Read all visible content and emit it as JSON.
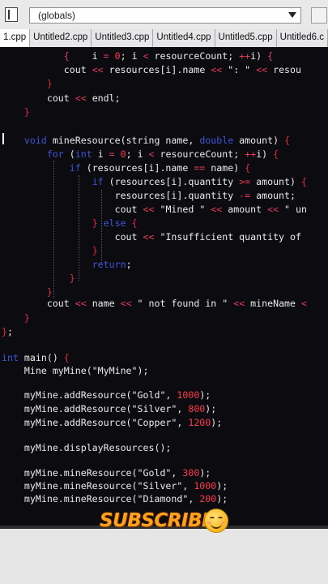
{
  "toolbar": {
    "scope_dropdown": "(globals)"
  },
  "tabs": [
    {
      "label": "1.cpp"
    },
    {
      "label": "Untitled2.cpp"
    },
    {
      "label": "Untitled3.cpp"
    },
    {
      "label": "Untitled4.cpp"
    },
    {
      "label": "Untitled5.cpp"
    },
    {
      "label": "Untitled6.c"
    }
  ],
  "overlay": {
    "subscribe_text": "SUBSCRIBE"
  },
  "colors": {
    "keyword": "#3f55d8",
    "number": "#ff3a4d",
    "operator": "#e43c58",
    "subscribe": "#ffa11c"
  },
  "code": {
    "l1": [
      {
        "t": "           "
      },
      {
        "t": "{",
        "c": "op"
      },
      {
        "t": "    i "
      },
      {
        "t": "=",
        "c": "op"
      },
      {
        "t": " "
      },
      {
        "t": "0",
        "c": "num"
      },
      {
        "t": "; i "
      },
      {
        "t": "<",
        "c": "op"
      },
      {
        "t": " resourceCount; "
      },
      {
        "t": "++",
        "c": "op"
      },
      {
        "t": "i) "
      },
      {
        "t": "{",
        "c": "op"
      }
    ],
    "l2": [
      {
        "t": "           cout "
      },
      {
        "t": "<<",
        "c": "op"
      },
      {
        "t": " resources[i].name "
      },
      {
        "t": "<<",
        "c": "op"
      },
      {
        "t": " \": \" "
      },
      {
        "t": "<<",
        "c": "op"
      },
      {
        "t": " resou"
      }
    ],
    "l3": [
      {
        "t": "        "
      },
      {
        "t": "}",
        "c": "red"
      }
    ],
    "l4": [
      {
        "t": "        cout "
      },
      {
        "t": "<<",
        "c": "op"
      },
      {
        "t": " endl;"
      }
    ],
    "l5": [
      {
        "t": "    "
      },
      {
        "t": "}",
        "c": "red"
      }
    ],
    "l6": [
      {
        "t": "    "
      },
      {
        "t": "void",
        "c": "kw"
      },
      {
        "t": " mineResource(string name, "
      },
      {
        "t": "double",
        "c": "kw"
      },
      {
        "t": " amount) "
      },
      {
        "t": "{",
        "c": "red"
      }
    ],
    "l7": [
      {
        "t": "        "
      },
      {
        "t": "for",
        "c": "kw"
      },
      {
        "t": " ("
      },
      {
        "t": "int",
        "c": "kw"
      },
      {
        "t": " i "
      },
      {
        "t": "=",
        "c": "op"
      },
      {
        "t": " "
      },
      {
        "t": "0",
        "c": "num"
      },
      {
        "t": "; i "
      },
      {
        "t": "<",
        "c": "op"
      },
      {
        "t": " resourceCount; "
      },
      {
        "t": "++",
        "c": "op"
      },
      {
        "t": "i) "
      },
      {
        "t": "{",
        "c": "red"
      }
    ],
    "l8": [
      {
        "t": "            "
      },
      {
        "t": "if",
        "c": "kw"
      },
      {
        "t": " (resources[i].name "
      },
      {
        "t": "==",
        "c": "op"
      },
      {
        "t": " name) "
      },
      {
        "t": "{",
        "c": "red"
      }
    ],
    "l9": [
      {
        "t": "                "
      },
      {
        "t": "if",
        "c": "kw"
      },
      {
        "t": " (resources[i].quantity "
      },
      {
        "t": ">=",
        "c": "op"
      },
      {
        "t": " amount) "
      },
      {
        "t": "{",
        "c": "red"
      }
    ],
    "l10": [
      {
        "t": "                    resources[i].quantity "
      },
      {
        "t": "-=",
        "c": "op"
      },
      {
        "t": " amount;"
      }
    ],
    "l11": [
      {
        "t": "                    cout "
      },
      {
        "t": "<<",
        "c": "op"
      },
      {
        "t": " \"Mined \" "
      },
      {
        "t": "<<",
        "c": "op"
      },
      {
        "t": " amount "
      },
      {
        "t": "<<",
        "c": "op"
      },
      {
        "t": " \" un"
      }
    ],
    "l12": [
      {
        "t": "                "
      },
      {
        "t": "}",
        "c": "red"
      },
      {
        "t": " "
      },
      {
        "t": "else",
        "c": "kw"
      },
      {
        "t": " "
      },
      {
        "t": "{",
        "c": "red"
      }
    ],
    "l13": [
      {
        "t": "                    cout "
      },
      {
        "t": "<<",
        "c": "op"
      },
      {
        "t": " \"Insufficient quantity of"
      }
    ],
    "l14": [
      {
        "t": "                "
      },
      {
        "t": "}",
        "c": "red"
      }
    ],
    "l15": [
      {
        "t": "                "
      },
      {
        "t": "return",
        "c": "kw"
      },
      {
        "t": ";"
      }
    ],
    "l16": [
      {
        "t": "            "
      },
      {
        "t": "}",
        "c": "red"
      }
    ],
    "l17": [
      {
        "t": "        "
      },
      {
        "t": "}",
        "c": "red"
      }
    ],
    "l18": [
      {
        "t": "        cout "
      },
      {
        "t": "<<",
        "c": "op"
      },
      {
        "t": " name "
      },
      {
        "t": "<<",
        "c": "op"
      },
      {
        "t": " \" not found in \" "
      },
      {
        "t": "<<",
        "c": "op"
      },
      {
        "t": " mineName "
      },
      {
        "t": "<",
        "c": "op"
      }
    ],
    "l19": [
      {
        "t": "    "
      },
      {
        "t": "}",
        "c": "red"
      }
    ],
    "l20": [
      {
        "t": "}",
        "c": "red"
      },
      {
        "t": ";"
      }
    ],
    "l21": [
      {
        "t": "int",
        "c": "kw"
      },
      {
        "t": " main() "
      },
      {
        "t": "{",
        "c": "red"
      }
    ],
    "l22": [
      {
        "t": "    Mine myMine(\"MyMine\");"
      }
    ],
    "l23": [
      {
        "t": "    myMine.addResource(\"Gold\", "
      },
      {
        "t": "1000",
        "c": "num"
      },
      {
        "t": ");"
      }
    ],
    "l24": [
      {
        "t": "    myMine.addResource(\"Silver\", "
      },
      {
        "t": "800",
        "c": "num"
      },
      {
        "t": ");"
      }
    ],
    "l25": [
      {
        "t": "    myMine.addResource(\"Copper\", "
      },
      {
        "t": "1200",
        "c": "num"
      },
      {
        "t": ");"
      }
    ],
    "l26": [
      {
        "t": "    myMine.displayResources();"
      }
    ],
    "l27": [
      {
        "t": "    myMine.mineResource(\"Gold\", "
      },
      {
        "t": "300",
        "c": "num"
      },
      {
        "t": ");"
      }
    ],
    "l28": [
      {
        "t": "    myMine.mineResource(\"Silver\", "
      },
      {
        "t": "1000",
        "c": "num"
      },
      {
        "t": ");"
      }
    ],
    "l29": [
      {
        "t": "    myMine.mineResource(\"Diamond\", "
      },
      {
        "t": "200",
        "c": "num"
      },
      {
        "t": ");"
      }
    ]
  }
}
